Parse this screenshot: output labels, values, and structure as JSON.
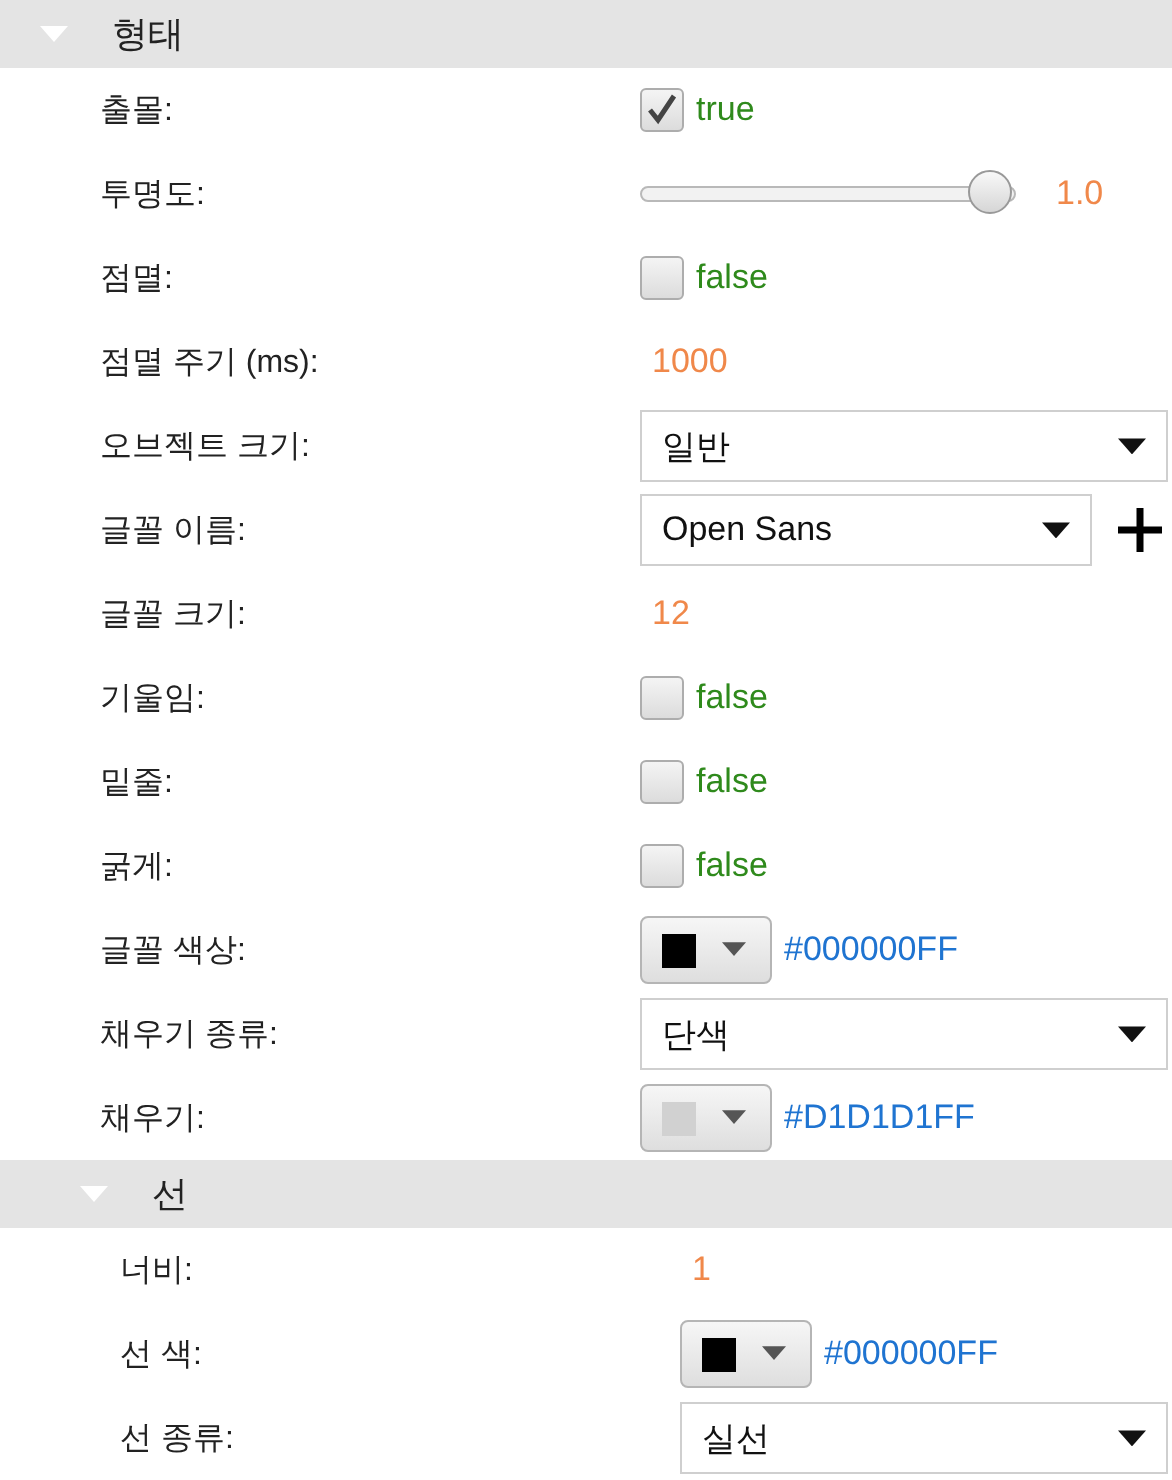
{
  "sections": [
    {
      "title": "형태",
      "expanded": true,
      "rows": [
        {
          "kind": "checkbox",
          "label": "출몰:",
          "checked": true,
          "value": "true"
        },
        {
          "kind": "slider",
          "label": "투명도:",
          "level": 1.0,
          "reading": "1.0"
        },
        {
          "kind": "checkbox",
          "label": "점멸:",
          "checked": false,
          "value": "false"
        },
        {
          "kind": "number",
          "label": "점멸 주기 (ms):",
          "value": "1000"
        },
        {
          "kind": "select",
          "label": "오브젝트 크기:",
          "value": "일반"
        },
        {
          "kind": "font",
          "label": "글꼴 이름:",
          "value": "Open Sans"
        },
        {
          "kind": "number",
          "label": "글꼴 크기:",
          "value": "12"
        },
        {
          "kind": "checkbox",
          "label": "기울임:",
          "checked": false,
          "value": "false"
        },
        {
          "kind": "checkbox",
          "label": "밑줄:",
          "checked": false,
          "value": "false"
        },
        {
          "kind": "checkbox",
          "label": "굵게:",
          "checked": false,
          "value": "false"
        },
        {
          "kind": "color",
          "label": "글꼴 색상:",
          "color": "#000000",
          "value": "#000000FF"
        },
        {
          "kind": "select",
          "label": "채우기 종류:",
          "value": "단색"
        },
        {
          "kind": "color",
          "label": "채우기:",
          "color": "#d1d1d1",
          "value": "#D1D1D1FF"
        }
      ],
      "children": [
        {
          "title": "선",
          "expanded": true,
          "rows": [
            {
              "kind": "number",
              "label": "너비:",
              "value": "1"
            },
            {
              "kind": "color",
              "label": "선 색:",
              "color": "#000000",
              "value": "#000000FF"
            },
            {
              "kind": "select",
              "label": "선 종류:",
              "value": "실선"
            }
          ]
        }
      ]
    }
  ]
}
